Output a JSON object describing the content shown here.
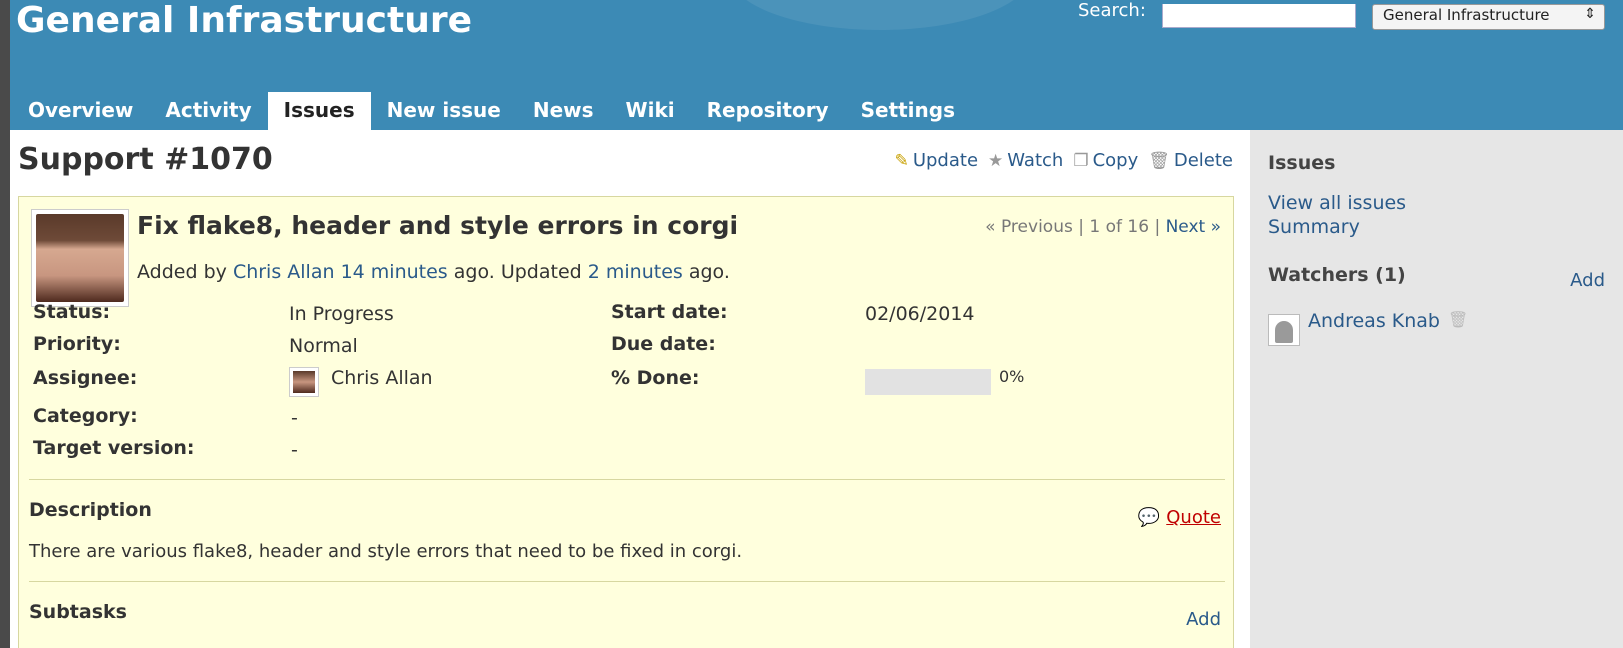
{
  "header": {
    "site_title": "General Infrastructure",
    "search_label": "Search:",
    "search_value": "",
    "project_select": "General Infrastructure",
    "tabs": [
      {
        "label": "Overview",
        "selected": false
      },
      {
        "label": "Activity",
        "selected": false
      },
      {
        "label": "Issues",
        "selected": true
      },
      {
        "label": "New issue",
        "selected": false
      },
      {
        "label": "News",
        "selected": false
      },
      {
        "label": "Wiki",
        "selected": false
      },
      {
        "label": "Repository",
        "selected": false
      },
      {
        "label": "Settings",
        "selected": false
      }
    ]
  },
  "page": {
    "title": "Support #1070",
    "actions": {
      "update": "Update",
      "watch": "Watch",
      "copy": "Copy",
      "delete": "Delete"
    }
  },
  "issue": {
    "subject": "Fix flake8, header and style errors in corgi",
    "nav": {
      "previous": "« Previous",
      "sep1": "|",
      "position": "1 of 16",
      "sep2": "|",
      "next": "Next »"
    },
    "author_line": {
      "prefix": "Added by",
      "author": "Chris Allan",
      "created": "14 minutes",
      "mid": "ago. Updated",
      "updated": "2 minutes",
      "suffix": "ago."
    },
    "attributes": {
      "status_label": "Status:",
      "status": "In Progress",
      "priority_label": "Priority:",
      "priority": "Normal",
      "assignee_label": "Assignee:",
      "assignee": "Chris Allan",
      "category_label": "Category:",
      "category": "-",
      "target_version_label": "Target version:",
      "target_version": "-",
      "start_date_label": "Start date:",
      "start_date": "02/06/2014",
      "due_date_label": "Due date:",
      "due_date": "",
      "done_label": "% Done:",
      "done": "0%",
      "done_fraction": 0
    },
    "description_heading": "Description",
    "quote": "Quote",
    "description": "There are various flake8, header and style errors that need to be fixed in corgi.",
    "subtasks_heading": "Subtasks",
    "subtasks_add": "Add"
  },
  "sidebar": {
    "issues_heading": "Issues",
    "view_all": "View all issues",
    "summary": "Summary",
    "watchers_heading": "Watchers (1)",
    "watchers_add": "Add",
    "watchers": [
      "Andreas Knab"
    ]
  },
  "icons": {
    "update": "pencil-icon",
    "watch": "star-icon",
    "copy": "copy-icon",
    "delete": "trash-icon",
    "quote": "comment-icon"
  },
  "colors": {
    "header": "#3c8ab5",
    "link": "#2a5a8a",
    "issue_bg": "#ffffdd",
    "sidebar_bg": "#e6e6e6",
    "quote": "#c00000"
  }
}
